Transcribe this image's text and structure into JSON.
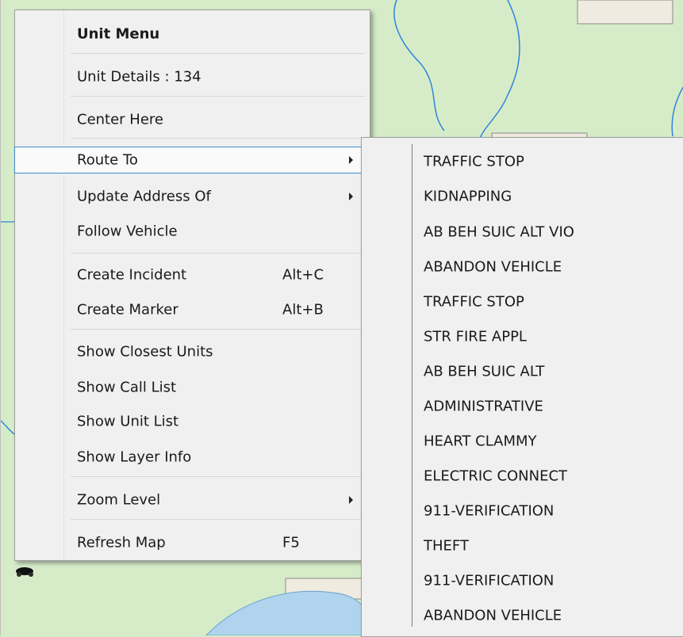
{
  "main_menu": {
    "header": "Unit Menu",
    "unit_details": "Unit Details : 134",
    "center_here": "Center Here",
    "route_to": "Route To",
    "update_address_of": "Update Address Of",
    "follow_vehicle": "Follow Vehicle",
    "create_incident": "Create Incident",
    "create_incident_shortcut": "Alt+C",
    "create_marker": "Create Marker",
    "create_marker_shortcut": "Alt+B",
    "show_closest_units": "Show Closest Units",
    "show_call_list": "Show Call List",
    "show_unit_list": "Show Unit List",
    "show_layer_info": "Show Layer Info",
    "zoom_level": "Zoom Level",
    "refresh_map": "Refresh Map",
    "refresh_map_shortcut": "F5"
  },
  "submenu": {
    "items": [
      "TRAFFIC STOP",
      "KIDNAPPING",
      "AB BEH SUIC ALT VIO",
      "ABANDON VEHICLE",
      "TRAFFIC STOP",
      "STR FIRE APPL",
      "AB BEH SUIC ALT",
      "ADMINISTRATIVE",
      "HEART CLAMMY",
      "ELECTRIC CONNECT",
      "911-VERIFICATION",
      "THEFT",
      "911-VERIFICATION",
      "ABANDON VEHICLE"
    ]
  },
  "colors": {
    "map_land": "#d6ecc9",
    "map_water": "#b0d4ee",
    "map_river": "#2e84d9",
    "menu_bg": "#f0f0f0",
    "highlight_border": "#3c8cd0"
  }
}
